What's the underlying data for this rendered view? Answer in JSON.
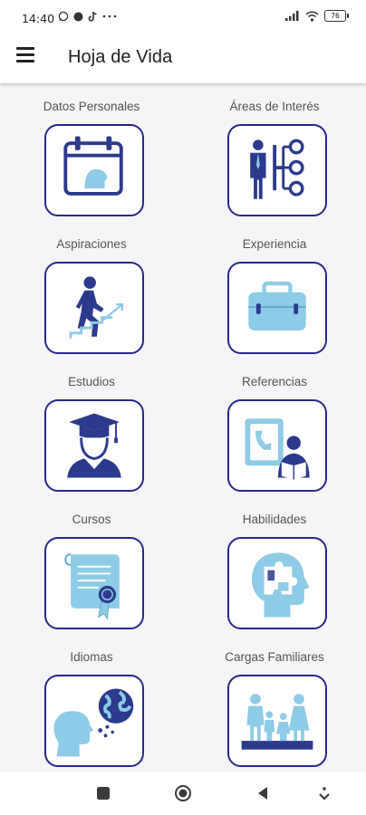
{
  "status": {
    "time": "14:40",
    "battery": "76"
  },
  "appbar": {
    "title": "Hoja de Vida"
  },
  "tiles": [
    {
      "label": "Datos Personales",
      "icon": "calendar-person-icon"
    },
    {
      "label": "Áreas de Interés",
      "icon": "org-chart-icon"
    },
    {
      "label": "Aspiraciones",
      "icon": "climbing-stairs-icon"
    },
    {
      "label": "Experiencia",
      "icon": "briefcase-icon"
    },
    {
      "label": "Estudios",
      "icon": "graduate-icon"
    },
    {
      "label": "Referencias",
      "icon": "reference-reader-icon"
    },
    {
      "label": "Cursos",
      "icon": "certificate-icon"
    },
    {
      "label": "Habilidades",
      "icon": "puzzle-head-icon"
    },
    {
      "label": "Idiomas",
      "icon": "speaking-globe-icon"
    },
    {
      "label": "Cargas Familiares",
      "icon": "family-icon"
    }
  ],
  "colors": {
    "border": "#27278c",
    "dark_blue": "#2b3a8c",
    "light_blue": "#8ecbe6"
  }
}
